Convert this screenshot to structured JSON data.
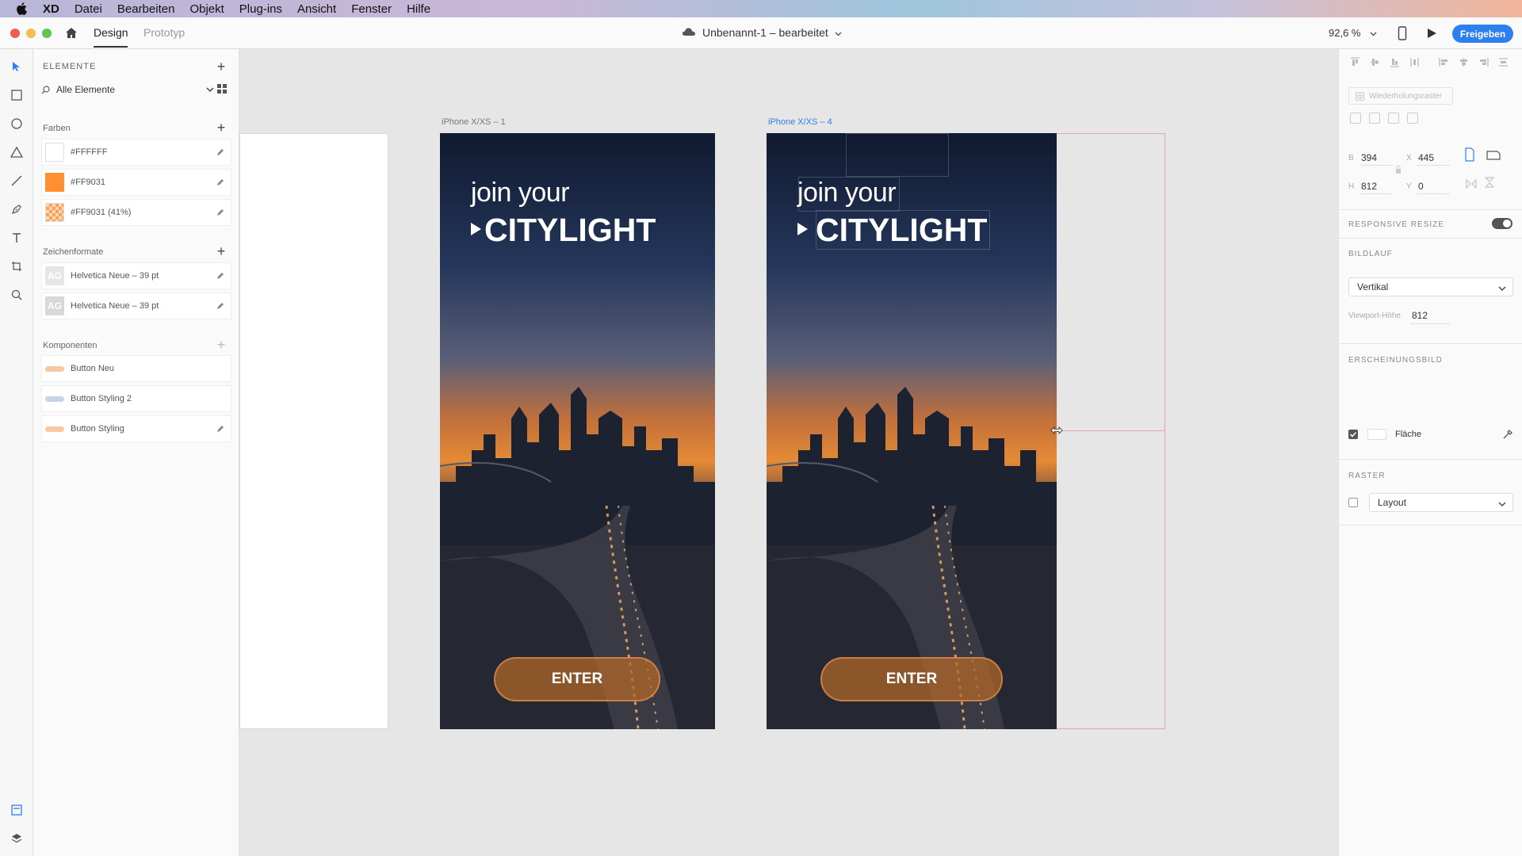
{
  "menubar": {
    "app": "XD",
    "items": [
      "Datei",
      "Bearbeiten",
      "Objekt",
      "Plug-ins",
      "Ansicht",
      "Fenster",
      "Hilfe"
    ]
  },
  "titlebar": {
    "tab_design": "Design",
    "tab_prototyp": "Prototyp",
    "document_title": "Unbenannt-1 – bearbeitet",
    "zoom": "92,6 %",
    "share_label": "Freigeben"
  },
  "assets": {
    "header": "ELEMENTE",
    "filter_label": "Alle Elemente",
    "colors_title": "Farben",
    "colors": [
      {
        "label": "#FFFFFF",
        "color": "#FFFFFF"
      },
      {
        "label": "#FF9031",
        "color": "#FF9031"
      },
      {
        "label": "#FF9031 (41%)",
        "color": "#FF9031"
      }
    ],
    "char_title": "Zeichenformate",
    "char_styles": [
      {
        "thumb": "AG",
        "label": "Helvetica Neue – 39 pt"
      },
      {
        "thumb": "AG",
        "label": "Helvetica Neue – 39 pt"
      }
    ],
    "comp_title": "Komponenten",
    "components": [
      {
        "label": "Button Neu",
        "color": "#f6c9a0"
      },
      {
        "label": "Button Styling 2",
        "color": "#c9d3e6"
      },
      {
        "label": "Button Styling",
        "color": "#f6c9a0"
      }
    ]
  },
  "canvas": {
    "artboard1_label": "iPhone X/XS – 1",
    "artboard4_label": "iPhone X/XS – 4",
    "headline_line1": "join your",
    "headline_line2": "CITYLIGHT",
    "button_label": "ENTER"
  },
  "inspector": {
    "repeat_grid": "Wiederholungsraster",
    "w_label": "B",
    "w_value": "394",
    "x_label": "X",
    "x_value": "445",
    "h_label": "H",
    "h_value": "812",
    "y_label": "Y",
    "y_value": "0",
    "responsive_title": "RESPONSIVE RESIZE",
    "scroll_title": "BILDLAUF",
    "scroll_value": "Vertikal",
    "viewport_label": "Viewport-Höhe",
    "viewport_value": "812",
    "appearance_title": "ERSCHEINUNGSBILD",
    "fill_label": "Fläche",
    "grid_title": "RASTER",
    "grid_value": "Layout"
  }
}
